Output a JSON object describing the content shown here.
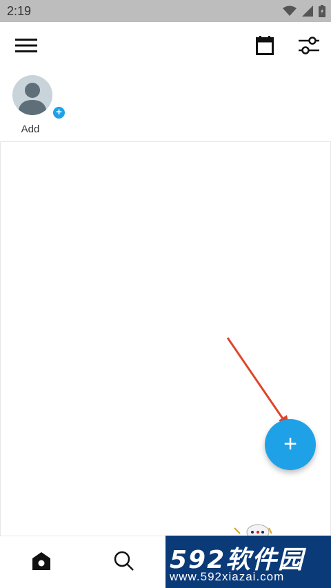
{
  "status_bar": {
    "time": "2:19",
    "icons": [
      "wifi-icon",
      "signal-icon",
      "battery-icon"
    ]
  },
  "app_bar": {
    "menu_icon": "menu-icon",
    "calendar_icon": "calendar-icon",
    "filter_icon": "sliders-icon"
  },
  "stories": {
    "add_label": "Add",
    "add_badge": "+"
  },
  "fab": {
    "label": "+",
    "color": "#1fa1e8"
  },
  "bottom_nav": {
    "items": [
      "home-icon",
      "search-icon"
    ]
  },
  "watermark": {
    "brand": "592软件园",
    "url": "www.592xiazai.com"
  },
  "colors": {
    "accent": "#1fa1e8",
    "status_bar": "#bdbdbd",
    "annotation_arrow": "#e0452b"
  }
}
